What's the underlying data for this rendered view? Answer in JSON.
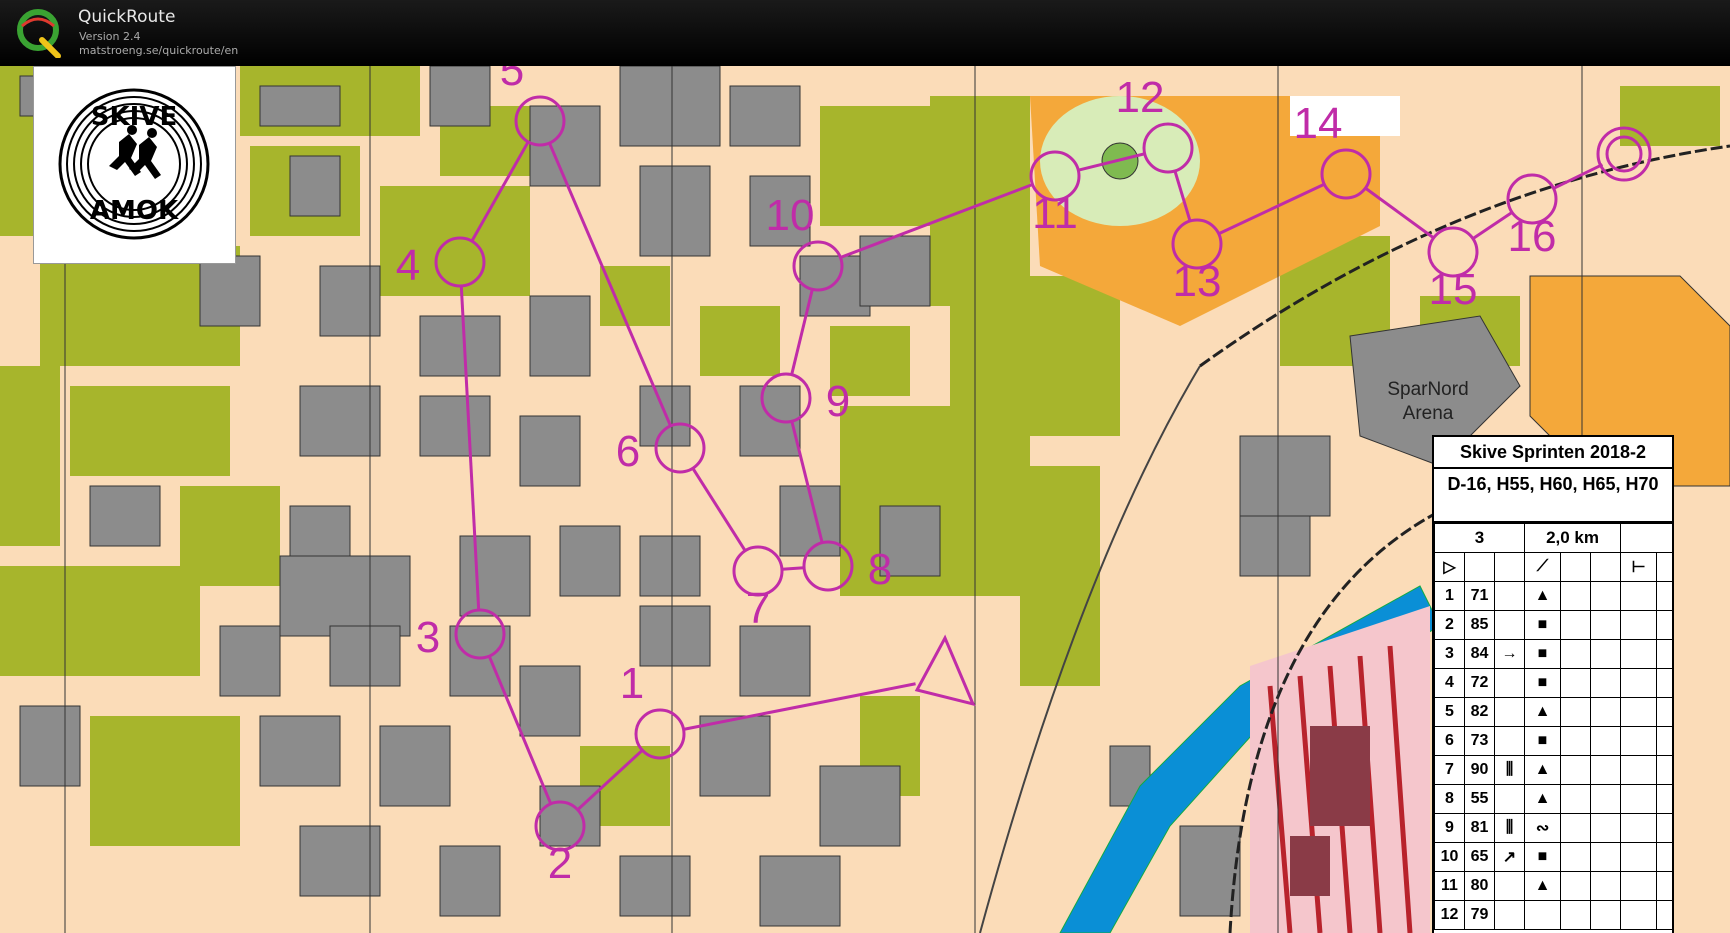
{
  "app": {
    "title": "QuickRoute",
    "version": "Version 2.4",
    "url": "matstroeng.se/quickroute/en",
    "logo_letter": "Q"
  },
  "club_logo": {
    "top_text": "SKIVE",
    "bottom_text": "AMOK"
  },
  "map": {
    "colors": {
      "street": "#fbdcb8",
      "building": "#8c8c8c",
      "vegetation": "#a7b52c",
      "open": "#f4a83a",
      "water": "#0a8fd6",
      "course": "#c02ca8",
      "forbidden": "#b8232c"
    },
    "arena_label_line1": "SparNord",
    "arena_label_line2": "Arena",
    "start": {
      "symbol": "triangle"
    },
    "controls": [
      {
        "number": "1",
        "label_pos": "above"
      },
      {
        "number": "2",
        "label_pos": "below"
      },
      {
        "number": "3",
        "label_pos": "left"
      },
      {
        "number": "4",
        "label_pos": "left"
      },
      {
        "number": "5",
        "label_pos": "above"
      },
      {
        "number": "6",
        "label_pos": "left"
      },
      {
        "number": "7",
        "label_pos": "below"
      },
      {
        "number": "8",
        "label_pos": "right"
      },
      {
        "number": "9",
        "label_pos": "right"
      },
      {
        "number": "10",
        "label_pos": "above"
      },
      {
        "number": "11",
        "label_pos": "below"
      },
      {
        "number": "12",
        "label_pos": "above"
      },
      {
        "number": "13",
        "label_pos": "below"
      },
      {
        "number": "14",
        "label_pos": "above"
      },
      {
        "number": "15",
        "label_pos": "below"
      },
      {
        "number": "16",
        "label_pos": "below"
      }
    ],
    "finish": {
      "symbol": "double-circle"
    }
  },
  "description_sheet": {
    "event": "Skive Sprinten 2018-2",
    "classes": "D-16, H55, H60, H65, H70",
    "course_number": "3",
    "length": "2,0 km",
    "rows": [
      {
        "n": "1",
        "code": "71",
        "c": "",
        "d": "▲"
      },
      {
        "n": "2",
        "code": "85",
        "c": "",
        "d": "■"
      },
      {
        "n": "3",
        "code": "84",
        "c": "→",
        "d": "■"
      },
      {
        "n": "4",
        "code": "72",
        "c": "",
        "d": "■"
      },
      {
        "n": "5",
        "code": "82",
        "c": "",
        "d": "▲"
      },
      {
        "n": "6",
        "code": "73",
        "c": "",
        "d": "■"
      },
      {
        "n": "7",
        "code": "90",
        "c": "⫼",
        "d": "▲"
      },
      {
        "n": "8",
        "code": "55",
        "c": "",
        "d": "▲"
      },
      {
        "n": "9",
        "code": "81",
        "c": "⫼",
        "d": "∾"
      },
      {
        "n": "10",
        "code": "65",
        "c": "↗",
        "d": "■"
      },
      {
        "n": "11",
        "code": "80",
        "c": "",
        "d": "▲"
      },
      {
        "n": "12",
        "code": "79",
        "c": "",
        "d": ""
      }
    ]
  }
}
